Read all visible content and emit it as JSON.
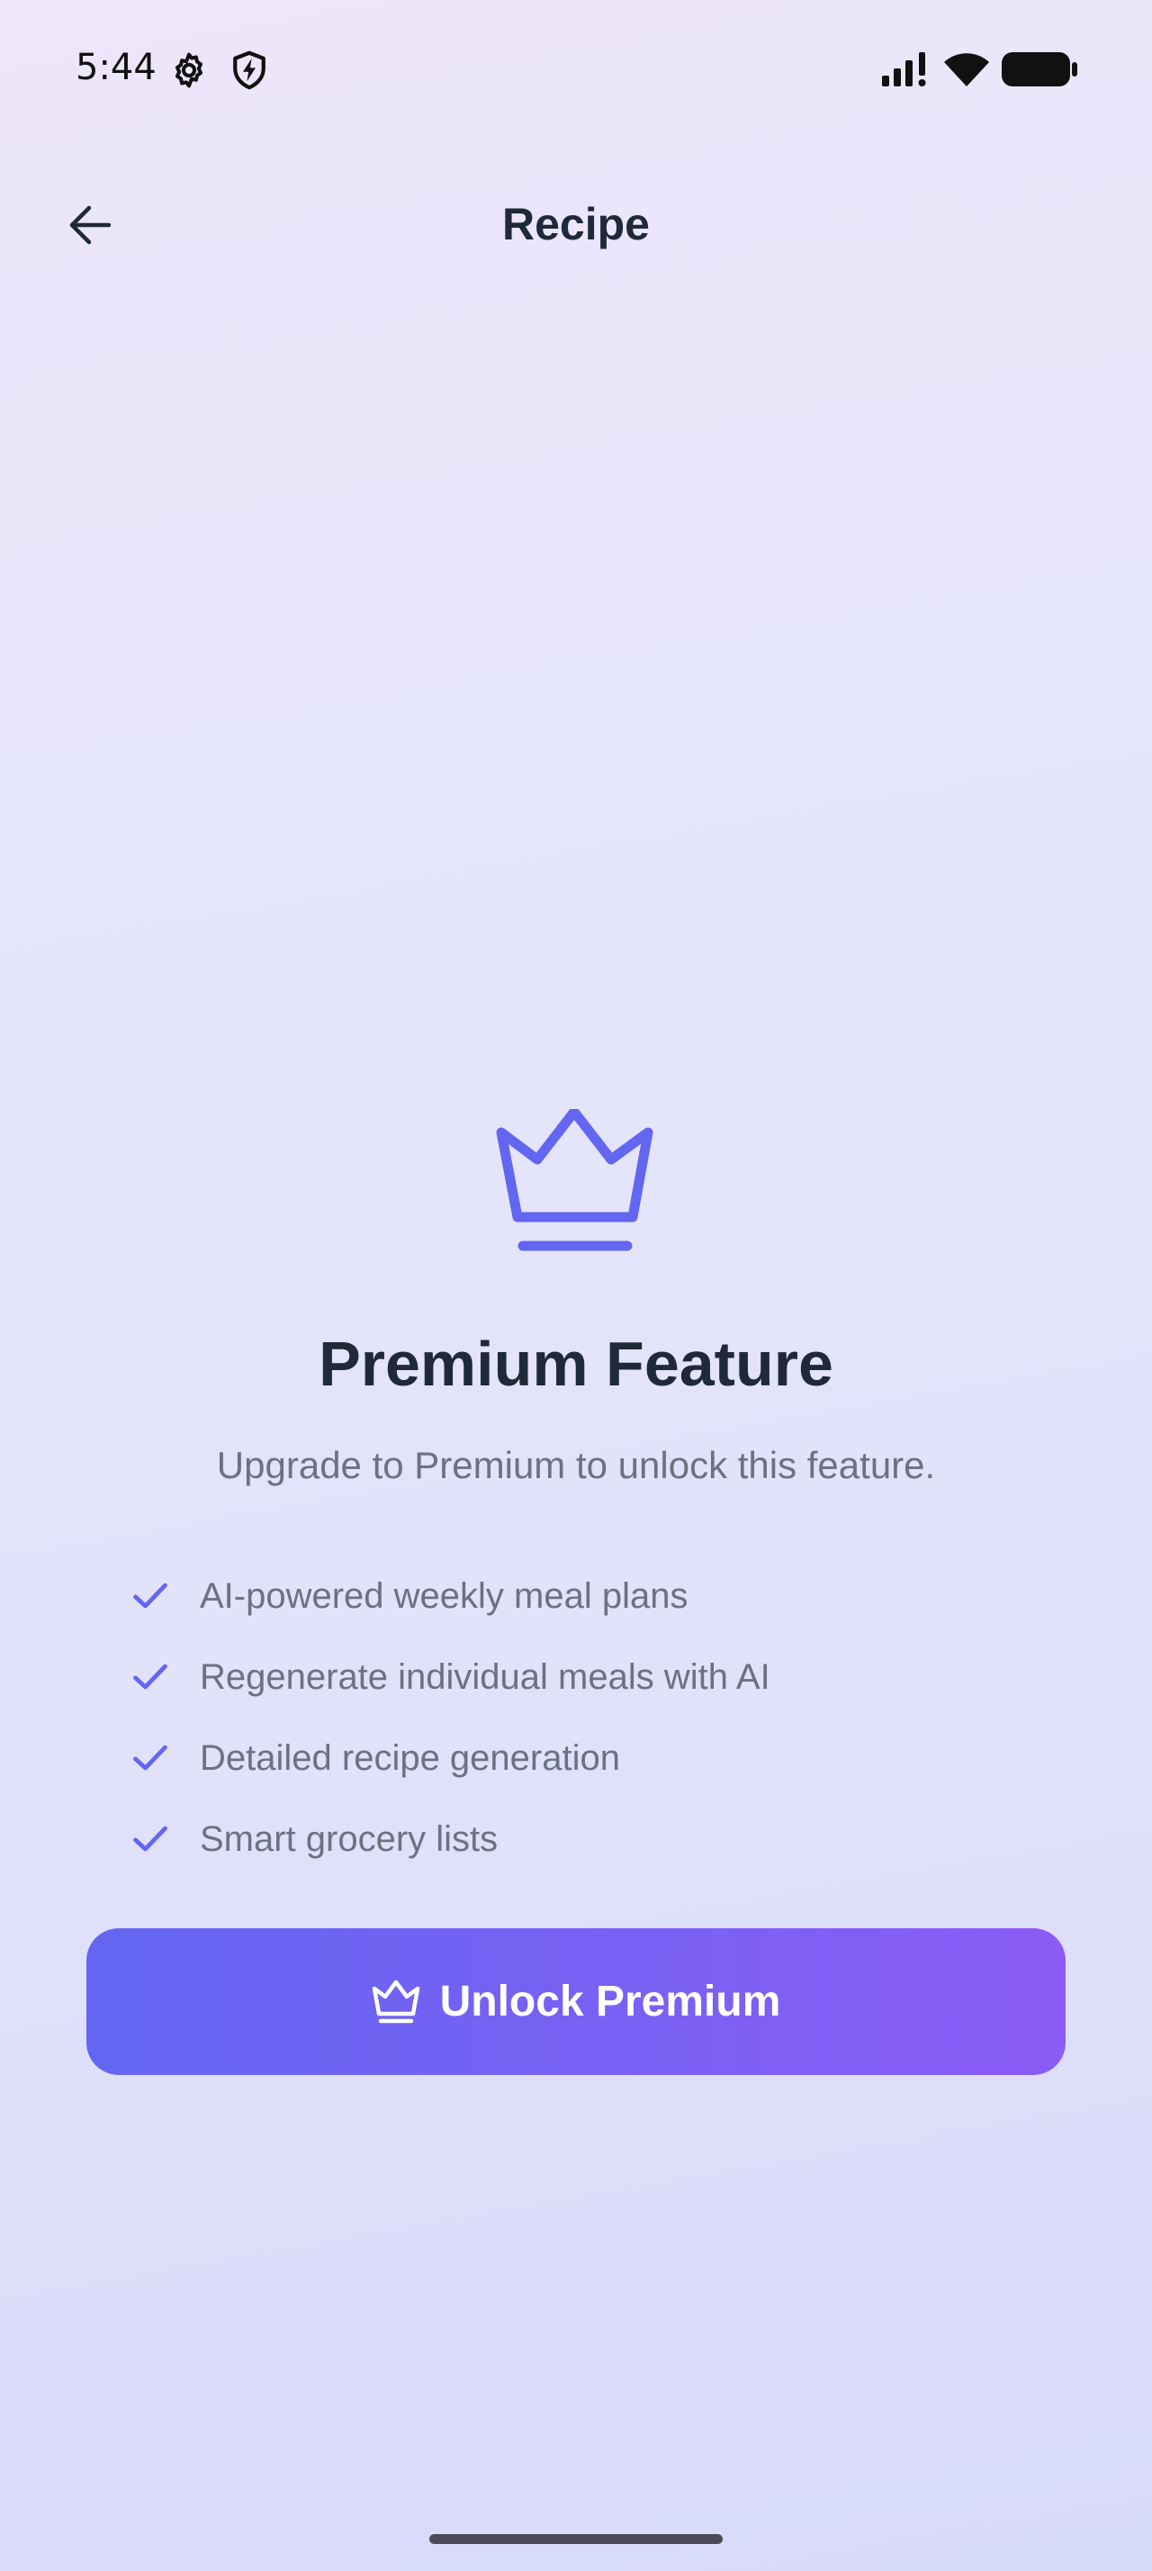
{
  "status_bar": {
    "time": "5:44",
    "left_icons": [
      "gear-icon",
      "shield-icon"
    ],
    "right_icons": [
      "signal-icon",
      "wifi-icon",
      "battery-icon"
    ]
  },
  "app_bar": {
    "back_icon": "arrow-left-icon",
    "title": "Recipe"
  },
  "premium": {
    "icon": "crown-icon",
    "title": "Premium Feature",
    "subtitle": "Upgrade to Premium to unlock this feature.",
    "features": [
      "AI-powered weekly meal plans",
      "Regenerate individual meals with AI",
      "Detailed recipe generation",
      "Smart grocery lists"
    ],
    "button_label": "Unlock Premium"
  },
  "colors": {
    "accent": "#6366F1",
    "accent_end": "#8B5CF6",
    "title_text": "#1F2937",
    "muted_text": "#6B7280"
  }
}
